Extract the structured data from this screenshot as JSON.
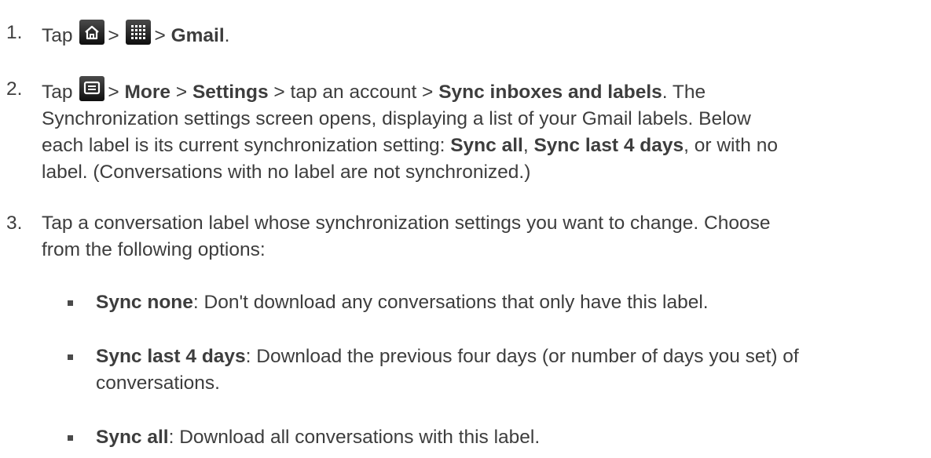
{
  "steps": [
    {
      "number": "1.",
      "parts": {
        "tap": "Tap",
        "sep1": ">",
        "sep2": ">",
        "gmail": "Gmail",
        "end": "."
      },
      "icons": [
        "home-icon",
        "apps-grid-icon"
      ]
    },
    {
      "number": "2.",
      "parts": {
        "tap": "Tap",
        "sep1": ">",
        "more": "More",
        "sep2": ">",
        "settings": "Settings",
        "sep3": "> tap an account >",
        "sync_inboxes": "Sync inboxes and labels",
        "line1_tail": ". The",
        "line2": "Synchronization settings screen opens, displaying a list of your Gmail labels. Below",
        "line3_a": "each label is its current synchronization setting:",
        "sync_all": "Sync all",
        "comma": ",",
        "sync_last": "Sync last 4 days",
        "line3_b": ", or with no",
        "line4": "label. (Conversations with no label are not synchronized.)"
      },
      "icons": [
        "menu-icon"
      ]
    },
    {
      "number": "3.",
      "parts": {
        "line1": "Tap a conversation label whose synchronization settings you want to change. Choose",
        "line2": "from the following options:"
      }
    }
  ],
  "options": [
    {
      "title": "Sync none",
      "text": ": Don't download any conversations that only have this label."
    },
    {
      "title": "Sync last 4 days",
      "text": ": Download the previous four days (or number of days you set) of",
      "text2": "conversations."
    },
    {
      "title": "Sync all",
      "text": ": Download all conversations with this label."
    }
  ]
}
